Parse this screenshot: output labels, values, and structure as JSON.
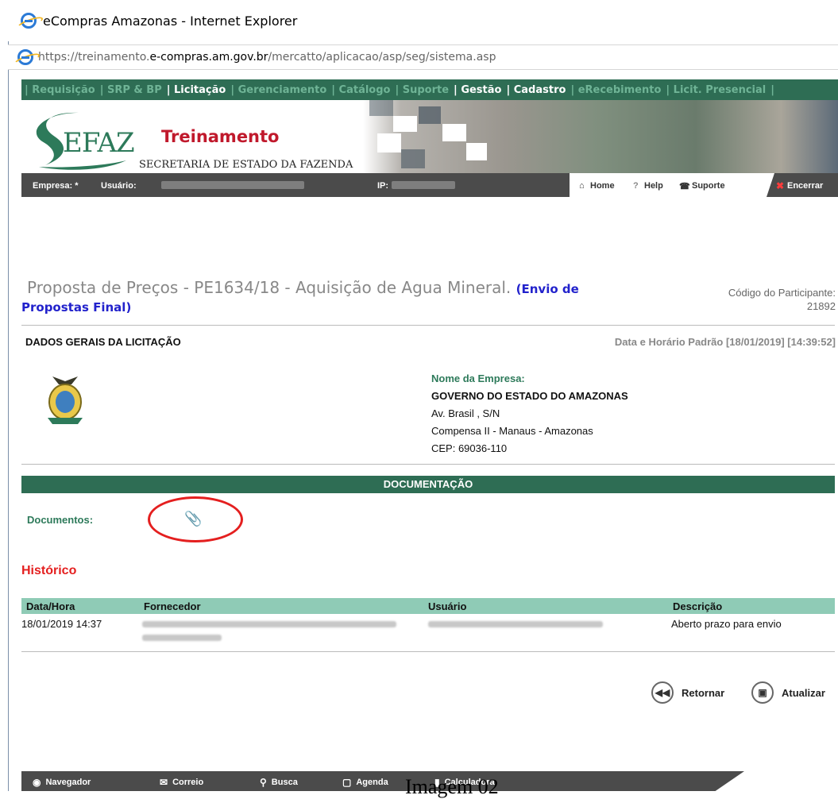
{
  "window": {
    "title": "eCompras Amazonas - Internet Explorer"
  },
  "address": {
    "prefix": "https://treinamento.",
    "domain": "e-compras.am.gov.br",
    "path": "/mercatto/aplicacao/asp/seg/sistema.asp"
  },
  "topnav": {
    "items": [
      "| Requisição",
      "| SRP & BP",
      "| Licitação",
      "| Gerenciamento",
      "| Catálogo",
      "| Suporte",
      "| Gestão",
      "| Cadastro",
      "| eRecebimento",
      "| Licit. Presencial",
      "|"
    ],
    "active": [
      "| Licitação",
      "| Gestão",
      "| Cadastro"
    ]
  },
  "header": {
    "logo_text": "EFAZ",
    "treinamento": "Treinamento",
    "secretaria": "SECRETARIA DE ESTADO DA FAZENDA"
  },
  "infobar": {
    "empresa": "Empresa: *",
    "usuario": "Usuário:",
    "ip": "IP:",
    "home": "Home",
    "help": "Help",
    "suporte": "Suporte",
    "encerrar": "Encerrar"
  },
  "page": {
    "title": "Proposta de Preços - PE1634/18 - Aquisição de Agua Mineral.",
    "status_a": "(Envio de",
    "status_b": "Propostas Final)",
    "codigo_label": "Código do Participante:",
    "codigo_value": "21892"
  },
  "dados": {
    "title": "DADOS GERAIS DA LICITAÇÃO",
    "datetime": "Data e Horário Padrão [18/01/2019] [14:39:52]"
  },
  "empresa": {
    "label": "Nome da Empresa:",
    "name": "GOVERNO DO ESTADO DO AMAZONAS",
    "address": "Av. Brasil , S/N",
    "city": "Compensa II - Manaus - Amazonas",
    "cep": "CEP: 69036-110"
  },
  "documentacao": {
    "title": "DOCUMENTAÇÃO",
    "label": "Documentos:"
  },
  "historico": {
    "title": "Histórico",
    "columns": [
      "Data/Hora",
      "Fornecedor",
      "Usuário",
      "Descrição"
    ],
    "rows": [
      {
        "datahora": "18/01/2019 14:37",
        "descricao": "Aberto prazo para envio"
      }
    ]
  },
  "actions": {
    "retornar": "Retornar",
    "atualizar": "Atualizar"
  },
  "bottombar": {
    "items": [
      "Navegador",
      "Correio",
      "Busca",
      "Agenda",
      "Calculadora"
    ]
  },
  "caption": "Imagem 02"
}
